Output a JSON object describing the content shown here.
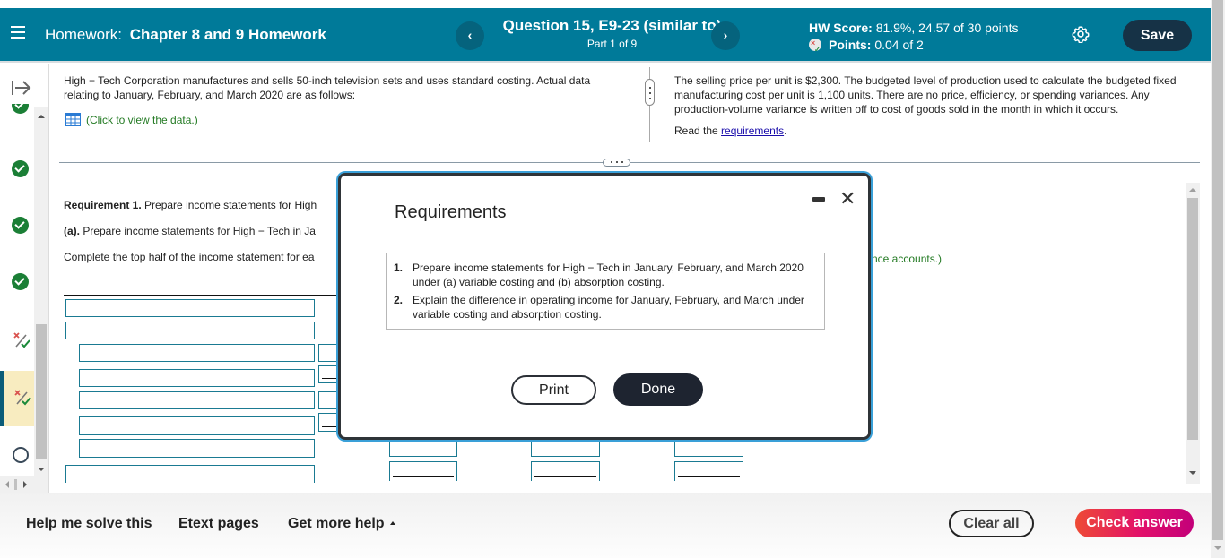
{
  "header": {
    "homework_prefix": "Homework:",
    "homework_title": "Chapter 8 and 9 Homework",
    "question_title": "Question 15, E9-23 (similar to)",
    "question_part": "Part 1 of 9",
    "prev_label": "‹",
    "next_label": "›",
    "hw_score_label": "HW Score:",
    "hw_score_value": "81.9%, 24.57 of 30 points",
    "points_label": "Points:",
    "points_value": "0.04 of 2",
    "save_label": "Save"
  },
  "sidebar": {
    "items": [
      {
        "status": "correct"
      },
      {
        "status": "correct"
      },
      {
        "status": "correct"
      },
      {
        "status": "correct"
      },
      {
        "status": "partial"
      },
      {
        "status": "partial",
        "active": true
      },
      {
        "status": "unanswered"
      }
    ]
  },
  "question": {
    "intro": "High − Tech Corporation manufactures and sells 50-inch television sets and uses standard costing. Actual data relating to January, February, and March 2020 are as follows:",
    "data_link": "(Click to view the data.)",
    "right_text": "The selling price per unit is $2,300. The budgeted level of production used to calculate the budgeted fixed manufacturing cost per unit is 1,100 units. There are no price, efficiency, or spending variances. Any production-volume variance is written off to cost of goods sold in the month in which it occurs.",
    "read_the": "Read the ",
    "requirements_link": "requirements",
    "read_tail": "."
  },
  "answer": {
    "req1_label": "Requirement 1.",
    "req1_text": " Prepare income statements for High",
    "part_a_label": "(a).",
    "part_a_text": " Prepare income statements for High − Tech in Ja",
    "instruction": "Complete the top half of the income statement for ea",
    "instruction_tail": "nce accounts.)"
  },
  "modal": {
    "title": "Requirements",
    "items": [
      {
        "num": "1.",
        "text": "Prepare income statements for High − Tech in January, February, and March 2020 under (a) variable costing and (b) absorption costing."
      },
      {
        "num": "2.",
        "text": "Explain the difference in operating income for January, February, and March under variable costing and absorption costing."
      }
    ],
    "print_label": "Print",
    "done_label": "Done",
    "close_label": "✕"
  },
  "footer": {
    "help_me_solve": "Help me solve this",
    "etext": "Etext pages",
    "more_help": "Get more help",
    "clear_all": "Clear all",
    "check_answer": "Check answer"
  }
}
